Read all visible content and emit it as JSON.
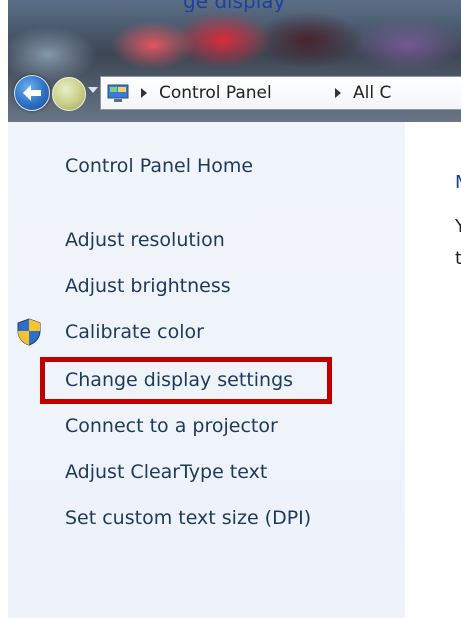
{
  "window": {
    "title_fragment": "ge display",
    "breadcrumb": [
      "Control Panel",
      "All C"
    ]
  },
  "sidebar": {
    "home": "Control Panel Home",
    "items": [
      {
        "label": "Adjust resolution"
      },
      {
        "label": "Adjust brightness"
      },
      {
        "label": "Calibrate color",
        "icon": "uac-shield-icon"
      },
      {
        "label": "Change display settings",
        "highlighted": true
      },
      {
        "label": "Connect to a projector"
      },
      {
        "label": "Adjust ClearType text"
      },
      {
        "label": "Set custom text size (DPI)"
      }
    ]
  },
  "content": {
    "heading_fragment": "M",
    "line1_fragment": "Y",
    "line2_fragment": "t"
  },
  "colors": {
    "link": "#1e395b",
    "highlight_box": "#c00000",
    "sidebar_bg": "#f0f4fb"
  }
}
